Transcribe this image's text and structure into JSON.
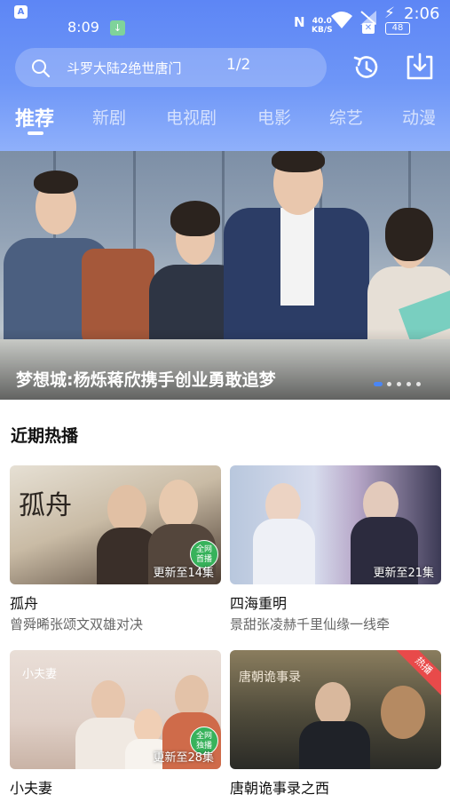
{
  "status_bar": {
    "time": "8:09",
    "clock": "2:06",
    "net_speed_value": "40.0",
    "net_speed_unit": "KB/S",
    "battery": "48",
    "app_icon_letter": "A",
    "nfc_letter": "N"
  },
  "search": {
    "query": "斗罗大陆2绝世唐门",
    "page": "1/2"
  },
  "tabs": [
    {
      "label": "推荐",
      "active": true
    },
    {
      "label": "新剧",
      "active": false
    },
    {
      "label": "电视剧",
      "active": false
    },
    {
      "label": "电影",
      "active": false
    },
    {
      "label": "综艺",
      "active": false
    },
    {
      "label": "动漫",
      "active": false
    }
  ],
  "banner": {
    "title": "梦想城:杨烁蒋欣携手创业勇敢追梦",
    "dot_count": 5,
    "active_dot": 0
  },
  "section": {
    "title": "近期热播"
  },
  "cards": [
    {
      "title": "孤舟",
      "subtitle": "曾舜晞张颂文双雄对决",
      "episode": "更新至14集",
      "poster_text": "孤舟",
      "badge": "全网首播"
    },
    {
      "title": "四海重明",
      "subtitle": "景甜张凌赫千里仙缘一线牵",
      "episode": "更新至21集",
      "poster_text": "",
      "badge": ""
    },
    {
      "title": "小夫妻",
      "subtitle": "",
      "episode": "更新至28集",
      "poster_text": "小夫妻",
      "badge": "全网独播"
    },
    {
      "title": "唐朝诡事录之西",
      "subtitle": "",
      "episode": "",
      "poster_text": "唐朝诡事录",
      "badge": "热播"
    }
  ],
  "colors": {
    "header_top": "#5d86f5",
    "header_bottom": "#8fb0fb",
    "active_dot": "#4a86f5",
    "badge_green": "#37b25b",
    "badge_red": "#e84a4a"
  },
  "icons": {
    "search": "search-icon",
    "history": "history-icon",
    "download": "download-icon"
  }
}
